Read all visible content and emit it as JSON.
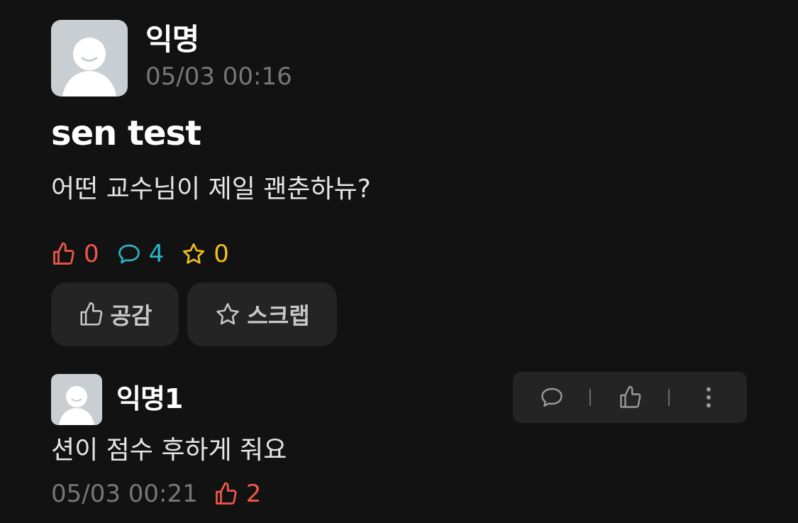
{
  "post": {
    "author": "익명",
    "timestamp": "05/03 00:16",
    "title": "sen test",
    "body": "어떤 교수님이 제일 괜춘하뉴?",
    "stats": {
      "likes": "0",
      "comments": "4",
      "scraps": "0"
    },
    "actions": {
      "like_label": "공감",
      "scrap_label": "스크랩"
    }
  },
  "comment": {
    "author": "익명1",
    "text": "션이 점수 후하게 줘요",
    "timestamp": "05/03 00:21",
    "likes": "2"
  },
  "colors": {
    "background": "#121212",
    "like": "#f0574a",
    "comment": "#2bb5c4",
    "scrap": "#f0c020",
    "muted": "#777777",
    "button_bg": "#242424"
  },
  "icons": {
    "avatar": "avatar-placeholder-icon",
    "like": "thumbs-up-icon",
    "comment": "speech-bubble-icon",
    "scrap": "star-icon",
    "more": "more-vertical-icon"
  }
}
